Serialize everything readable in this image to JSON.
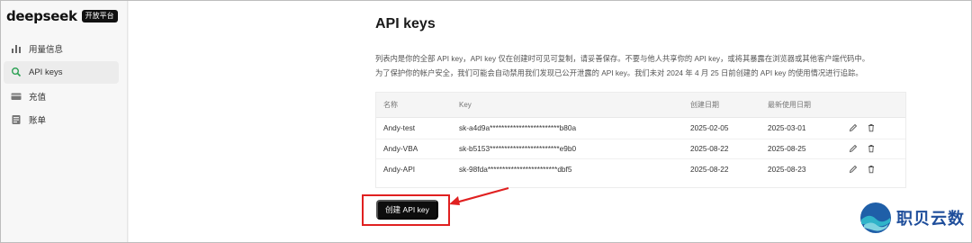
{
  "brand": {
    "name": "deepseek",
    "badge": "开放平台"
  },
  "sidebar": {
    "items": [
      {
        "label": "用量信息",
        "icon": "bar-chart-icon"
      },
      {
        "label": "API keys",
        "icon": "search-icon",
        "active": true
      },
      {
        "label": "充值",
        "icon": "card-icon"
      },
      {
        "label": "账单",
        "icon": "bill-icon"
      }
    ]
  },
  "main": {
    "title": "API keys",
    "desc_line1": "列表内是你的全部 API key，API key 仅在创建时可见可复制，请妥善保存。不要与他人共享你的 API key，或将其暴露在浏览器或其他客户端代码中。",
    "desc_line2": "为了保护你的帐户安全，我们可能会自动禁用我们发现已公开泄露的 API key。我们未对 2024 年 4 月 25 日前创建的 API key 的使用情况进行追踪。",
    "table": {
      "headers": {
        "name": "名称",
        "key": "Key",
        "created": "创建日期",
        "last_used": "最新使用日期"
      },
      "rows": [
        {
          "name": "Andy-test",
          "key": "sk-a4d9a************************b80a",
          "created": "2025-02-05",
          "last_used": "2025-03-01"
        },
        {
          "name": "Andy-VBA",
          "key": "sk-b5153************************e9b0",
          "created": "2025-08-22",
          "last_used": "2025-08-25"
        },
        {
          "name": "Andy-API",
          "key": "sk-98fda************************dbf5",
          "created": "2025-08-22",
          "last_used": "2025-08-23"
        }
      ]
    },
    "create_button": "创建 API key"
  },
  "watermark": {
    "text": "职贝云数"
  },
  "colors": {
    "highlight": "#e02020",
    "button": "#0d0d0d",
    "watermark": "#1f4e9b"
  }
}
